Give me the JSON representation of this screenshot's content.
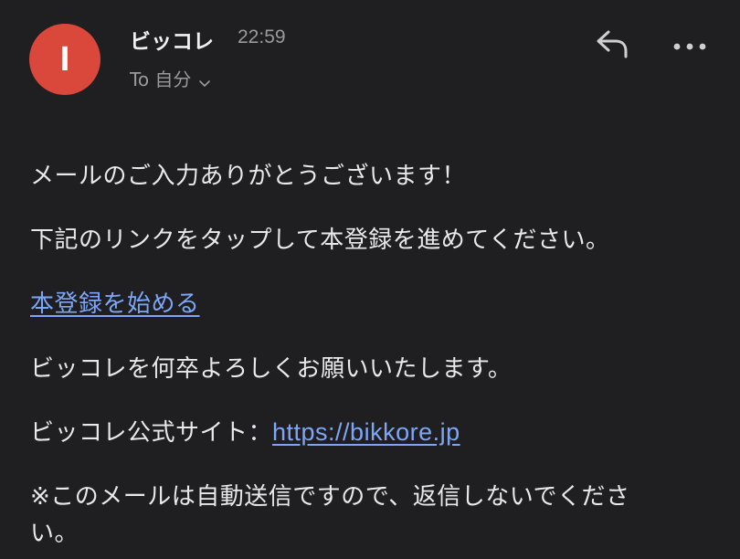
{
  "header": {
    "avatar_letter": "I",
    "avatar_color": "#d9483b",
    "sender": "ビッコレ",
    "time": "22:59",
    "recipient": "To 自分",
    "recipient_chevron_icon": "chevron-down-icon",
    "reply_icon": "reply-icon",
    "more_icon": "more-horizontal-icon"
  },
  "body": {
    "line1": "メールのご入力ありがとうございます！",
    "line2": "下記のリンクをタップして本登録を進めてください。",
    "register_link": "本登録を始める",
    "line4": "ビッコレを何卒よろしくお願いいたします。",
    "site_label": "ビッコレ公式サイト：",
    "site_url": "https://bikkore.jp",
    "line6a": "※このメールは自動送信ですので、返信しないでくださ",
    "line6b": "い。"
  },
  "colors": {
    "background": "#1f1f22",
    "link": "#7ea6f7"
  }
}
